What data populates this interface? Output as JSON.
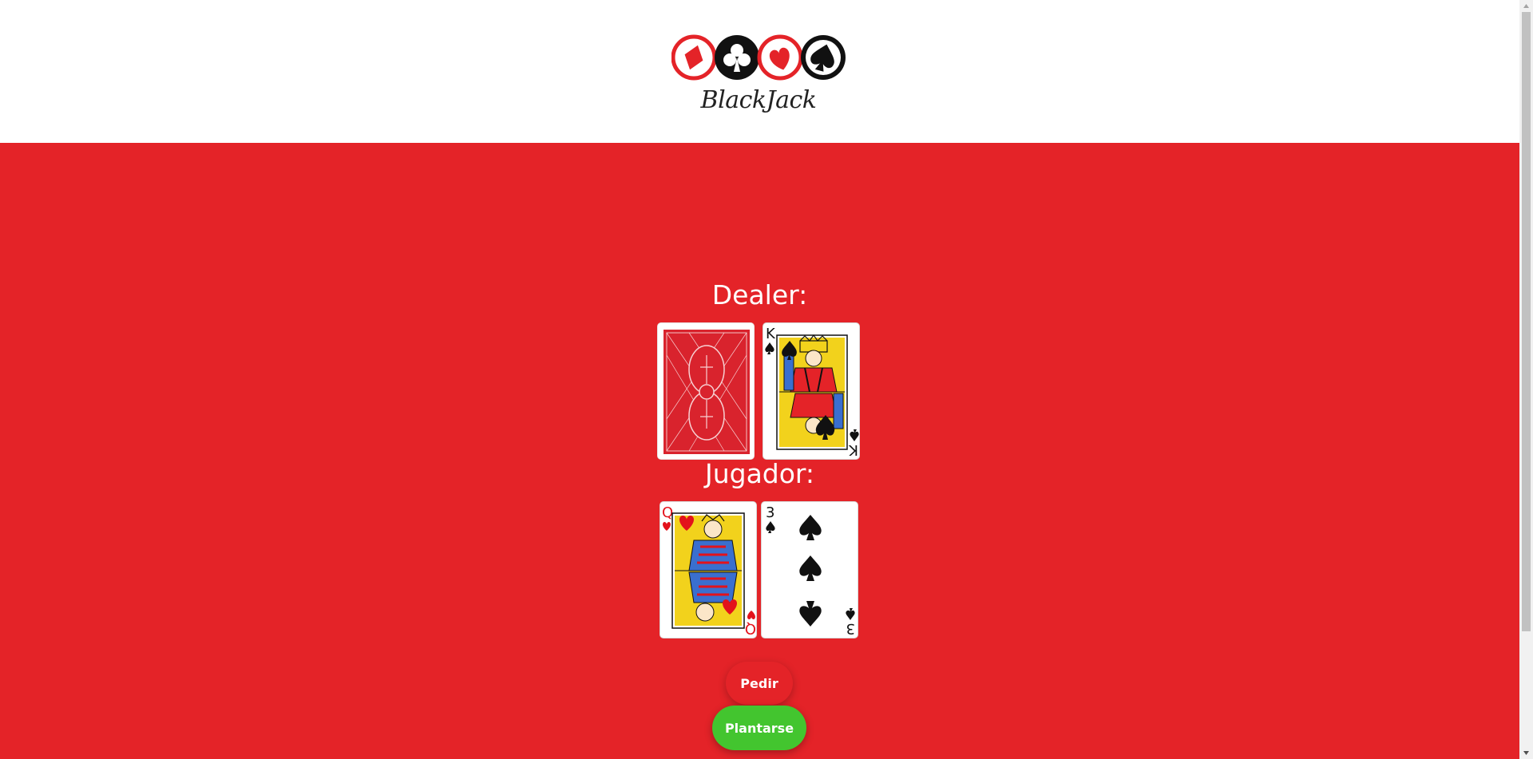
{
  "logo": {
    "text": "BlackJack",
    "suits": [
      "diamond-icon",
      "club-icon",
      "heart-icon",
      "spade-icon"
    ]
  },
  "dealer": {
    "label": "Dealer:",
    "cards": [
      {
        "face": "back"
      },
      {
        "rank": "K",
        "suit": "spade",
        "color": "#111111"
      }
    ]
  },
  "player": {
    "label": "Jugador:",
    "cards": [
      {
        "rank": "Q",
        "suit": "heart",
        "color": "#e3121b"
      },
      {
        "rank": "3",
        "suit": "spade",
        "color": "#111111"
      }
    ]
  },
  "buttons": {
    "pedir": "Pedir",
    "plantarse": "Plantarse"
  },
  "colors": {
    "table": "#e42328",
    "pedir": "#e42328",
    "plantarse": "#43c52f",
    "card_back": "#d9232d"
  }
}
